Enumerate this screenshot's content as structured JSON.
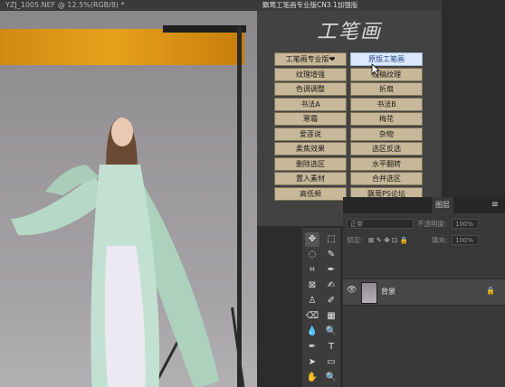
{
  "document_tab": "YZJ_1005.NEF @ 12.5%(RGB/8) *",
  "plugin": {
    "title": "飘莺工笔画专业版CN3.1加强版",
    "logo": "工笔画",
    "buttons": [
      {
        "label": "工笔画专业版❤",
        "active": false
      },
      {
        "label": "原版工笔画",
        "active": true
      },
      {
        "label": "纹理增强",
        "active": false
      },
      {
        "label": "线稿纹理",
        "active": false
      },
      {
        "label": "色调调整",
        "active": false
      },
      {
        "label": "折扇",
        "active": false
      },
      {
        "label": "书法A",
        "active": false
      },
      {
        "label": "书法B",
        "active": false
      },
      {
        "label": "寒霜",
        "active": false
      },
      {
        "label": "梅花",
        "active": false
      },
      {
        "label": "爱莲说",
        "active": false
      },
      {
        "label": "杂物",
        "active": false
      },
      {
        "label": "柔焦效果",
        "active": false
      },
      {
        "label": "选区反选",
        "active": false
      },
      {
        "label": "删除选区",
        "active": false
      },
      {
        "label": "水平翻转",
        "active": false
      },
      {
        "label": "置入素材",
        "active": false
      },
      {
        "label": "合并选区",
        "active": false
      },
      {
        "label": "高低频",
        "active": false
      },
      {
        "label": "飘莺PS论坛",
        "active": false
      }
    ]
  },
  "toolbar": {
    "tools": [
      "move-icon",
      "marquee-icon",
      "lasso-icon",
      "quick-select-icon",
      "crop-icon",
      "eyedropper-icon",
      "frame-icon",
      "brush-icon",
      "stamp-icon",
      "history-brush-icon",
      "eraser-icon",
      "gradient-icon",
      "blur-icon",
      "dodge-icon",
      "pen-icon",
      "type-icon",
      "path-select-icon",
      "shape-icon",
      "hand-icon",
      "zoom-icon"
    ],
    "glyphs": [
      "✥",
      "⬚",
      "◌",
      "✎",
      "⌗",
      "✒",
      "⊠",
      "✍",
      "♙",
      "✐",
      "⌫",
      "▦",
      "💧",
      "🔍",
      "✒",
      "T",
      "➤",
      "▭",
      "✋",
      "🔍"
    ]
  },
  "layers": {
    "tab": "图层",
    "blend_mode": "正常",
    "opacity_label": "不透明度:",
    "opacity_value": "100%",
    "lock_label": "锁定:",
    "fill_label": "填充:",
    "fill_value": "100%",
    "layer_name": "背景"
  }
}
